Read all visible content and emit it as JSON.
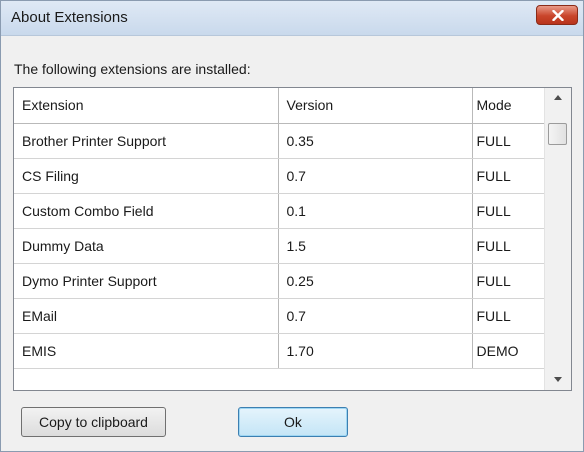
{
  "window": {
    "title": "About Extensions"
  },
  "intro_text": "The following extensions are installed:",
  "table": {
    "columns": [
      "Extension",
      "Version",
      "Mode"
    ],
    "rows": [
      [
        "Brother Printer Support",
        "0.35",
        "FULL"
      ],
      [
        "CS Filing",
        "0.7",
        "FULL"
      ],
      [
        "Custom Combo Field",
        "0.1",
        "FULL"
      ],
      [
        "Dummy Data",
        "1.5",
        "FULL"
      ],
      [
        "Dymo Printer Support",
        "0.25",
        "FULL"
      ],
      [
        "EMail",
        "0.7",
        "FULL"
      ],
      [
        "EMIS",
        "1.70",
        "DEMO"
      ]
    ]
  },
  "buttons": {
    "copy_label": "Copy to clipboard",
    "ok_label": "Ok"
  },
  "icons": {
    "close": "close-icon",
    "scroll_up": "chevron-up-icon",
    "scroll_down": "chevron-down-icon"
  },
  "colors": {
    "close_button": "#c9452b",
    "ok_button": "#c4e5f6"
  }
}
